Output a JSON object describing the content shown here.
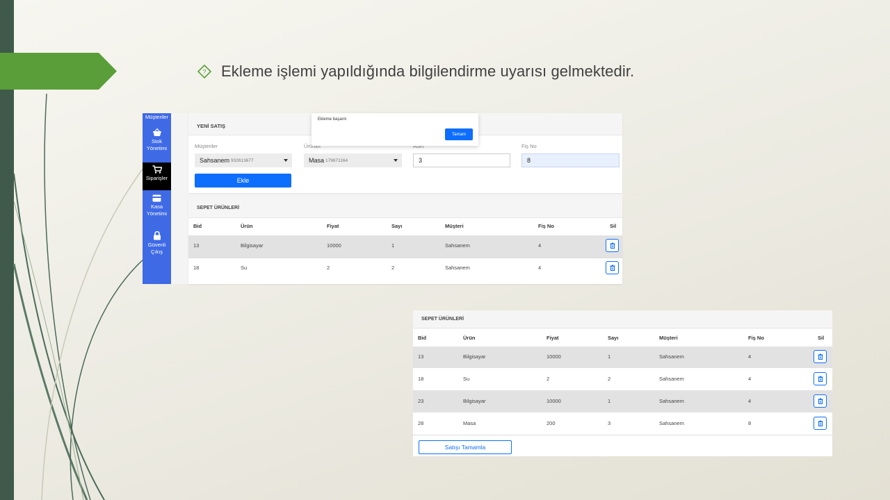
{
  "slide": {
    "bullet_text": "Ekleme işlemi yapıldığında bilgilendirme uyarısı gelmektedir.",
    "accent_green": "#5a9e3a",
    "left_bar_color": "#3f5a4a"
  },
  "shot1": {
    "sidebar": {
      "color": "#3f6ae6",
      "items": [
        {
          "label": "Müşteriler",
          "icon": "users-icon"
        },
        {
          "label": "Stok Yönetimi",
          "icon": "basket-icon"
        },
        {
          "label": "Siparişler",
          "icon": "cart-icon",
          "active": true
        },
        {
          "label": "Kasa Yönetimi",
          "icon": "card-icon"
        },
        {
          "label": "Güvenli Çıkış",
          "icon": "lock-icon"
        }
      ]
    },
    "new_sale": {
      "title": "YENİ SATIŞ",
      "customer_label": "Müşteriler",
      "customer_value": "Sahsanem",
      "customer_phone": "932613677",
      "product_label": "Ürünler",
      "product_value": "Masa",
      "product_code": "179671164",
      "qty_label": "Adet",
      "qty_value": "3",
      "receipt_label": "Fiş No",
      "receipt_value": "8",
      "add_button": "Ekle"
    },
    "modal": {
      "message": "Ekleme başarılı",
      "ok_button": "Tamam"
    },
    "cart": {
      "title": "SEPET ÜRÜNLERİ",
      "columns": [
        "Bid",
        "Ürün",
        "Fiyat",
        "Sayı",
        "Müşteri",
        "Fiş No",
        "Sil"
      ],
      "rows": [
        [
          "13",
          "Bilgisayar",
          "10000",
          "1",
          "Sahsanem",
          "4"
        ],
        [
          "18",
          "Su",
          "2",
          "2",
          "Sahsanem",
          "4"
        ]
      ]
    }
  },
  "shot2": {
    "cart": {
      "title": "SEPET ÜRÜNLERİ",
      "columns": [
        "Bid",
        "Ürün",
        "Fiyat",
        "Sayı",
        "Müşteri",
        "Fiş No",
        "Sil"
      ],
      "rows": [
        [
          "13",
          "Bilgisayar",
          "10000",
          "1",
          "Sahsanem",
          "4"
        ],
        [
          "18",
          "Su",
          "2",
          "2",
          "Sahsanem",
          "4"
        ],
        [
          "23",
          "Bilgisayar",
          "10000",
          "1",
          "Sahsanem",
          "4"
        ],
        [
          "28",
          "Masa",
          "200",
          "3",
          "Sahsanem",
          "8"
        ]
      ],
      "complete_button": "Satışı Tamamla"
    }
  }
}
